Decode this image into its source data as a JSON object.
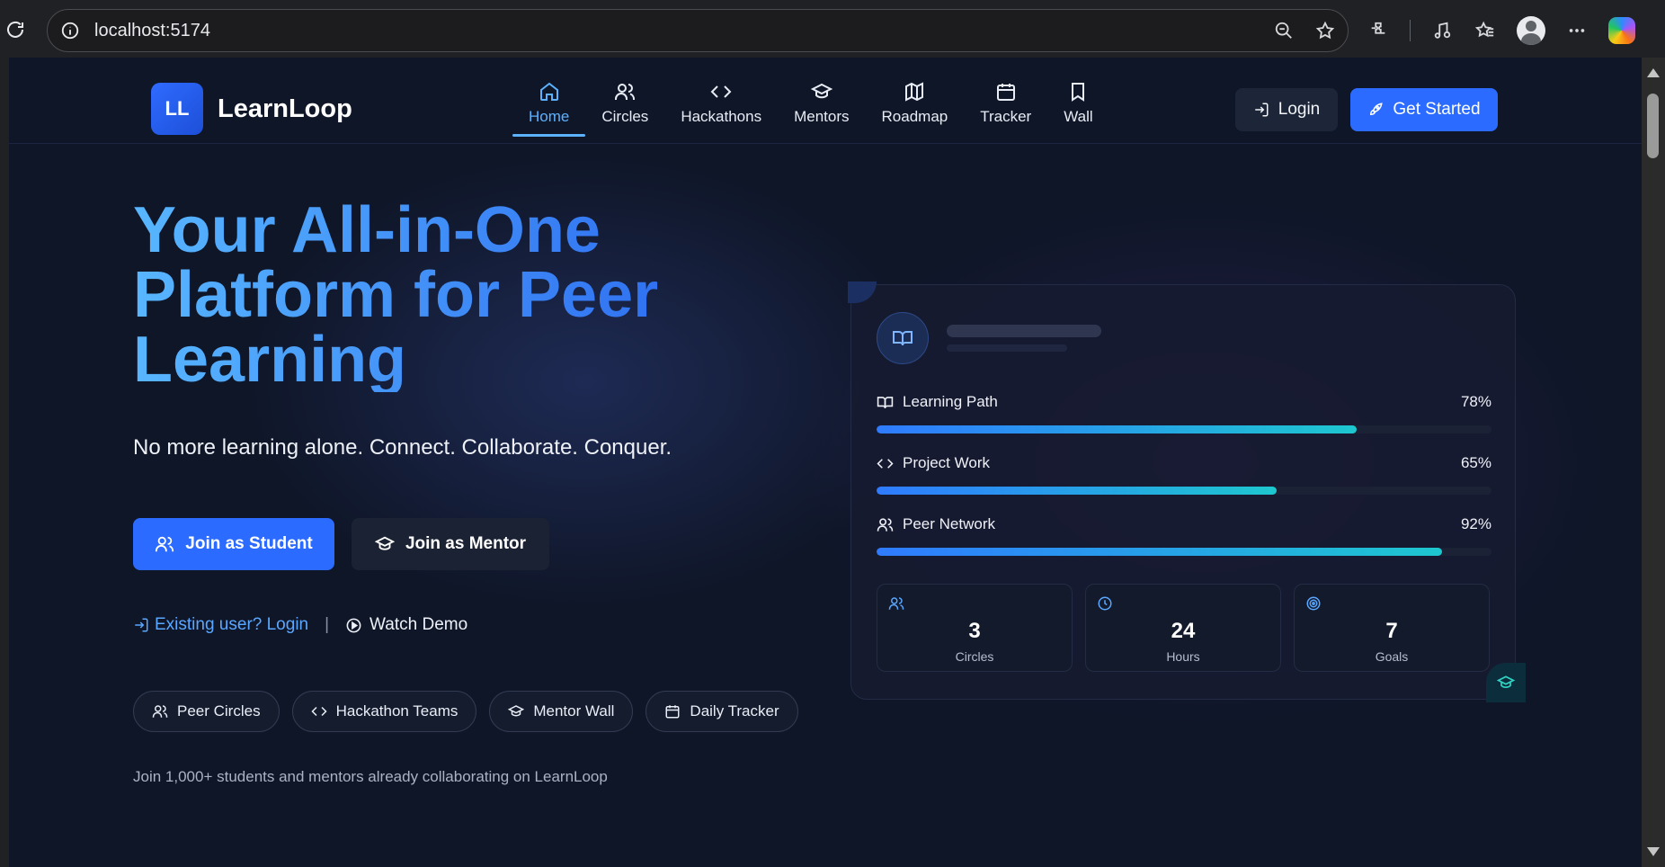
{
  "browser": {
    "url": "localhost:5174"
  },
  "brand": {
    "logo_initials": "LL",
    "name": "LearnLoop"
  },
  "nav": {
    "items": [
      {
        "label": "Home",
        "icon": "home-icon",
        "active": true
      },
      {
        "label": "Circles",
        "icon": "users-icon",
        "active": false
      },
      {
        "label": "Hackathons",
        "icon": "code-icon",
        "active": false
      },
      {
        "label": "Mentors",
        "icon": "graduation-cap-icon",
        "active": false
      },
      {
        "label": "Roadmap",
        "icon": "map-icon",
        "active": false
      },
      {
        "label": "Tracker",
        "icon": "calendar-icon",
        "active": false
      },
      {
        "label": "Wall",
        "icon": "bookmark-icon",
        "active": false
      }
    ],
    "login_label": "Login",
    "get_started_label": "Get Started"
  },
  "hero": {
    "title": "Your All-in-One Platform for Peer Learning",
    "subtitle": "No more learning alone. Connect. Collaborate. Conquer.",
    "join_student_label": "Join as Student",
    "join_mentor_label": "Join as Mentor",
    "existing_login_label": "Existing user? Login",
    "separator": "|",
    "watch_demo_label": "Watch Demo",
    "chips": [
      {
        "label": "Peer Circles",
        "icon": "users-icon"
      },
      {
        "label": "Hackathon Teams",
        "icon": "code-icon"
      },
      {
        "label": "Mentor Wall",
        "icon": "graduation-cap-icon"
      },
      {
        "label": "Daily Tracker",
        "icon": "calendar-icon"
      }
    ],
    "footnote": "Join 1,000+ students and mentors already collaborating on LearnLoop"
  },
  "card": {
    "metrics": [
      {
        "label": "Learning Path",
        "value_text": "78%",
        "value": 78,
        "icon": "book-icon"
      },
      {
        "label": "Project Work",
        "value_text": "65%",
        "value": 65,
        "icon": "code-icon"
      },
      {
        "label": "Peer Network",
        "value_text": "92%",
        "value": 92,
        "icon": "users-icon"
      }
    ],
    "stats": [
      {
        "value": "3",
        "label": "Circles",
        "icon": "users-icon"
      },
      {
        "value": "24",
        "label": "Hours",
        "icon": "clock-icon"
      },
      {
        "value": "7",
        "label": "Goals",
        "icon": "target-icon"
      }
    ]
  },
  "colors": {
    "accent": "#2c6bff",
    "active_nav": "#5cb2ff",
    "background": "#0f1628",
    "progress_end": "#1ec7cf"
  }
}
